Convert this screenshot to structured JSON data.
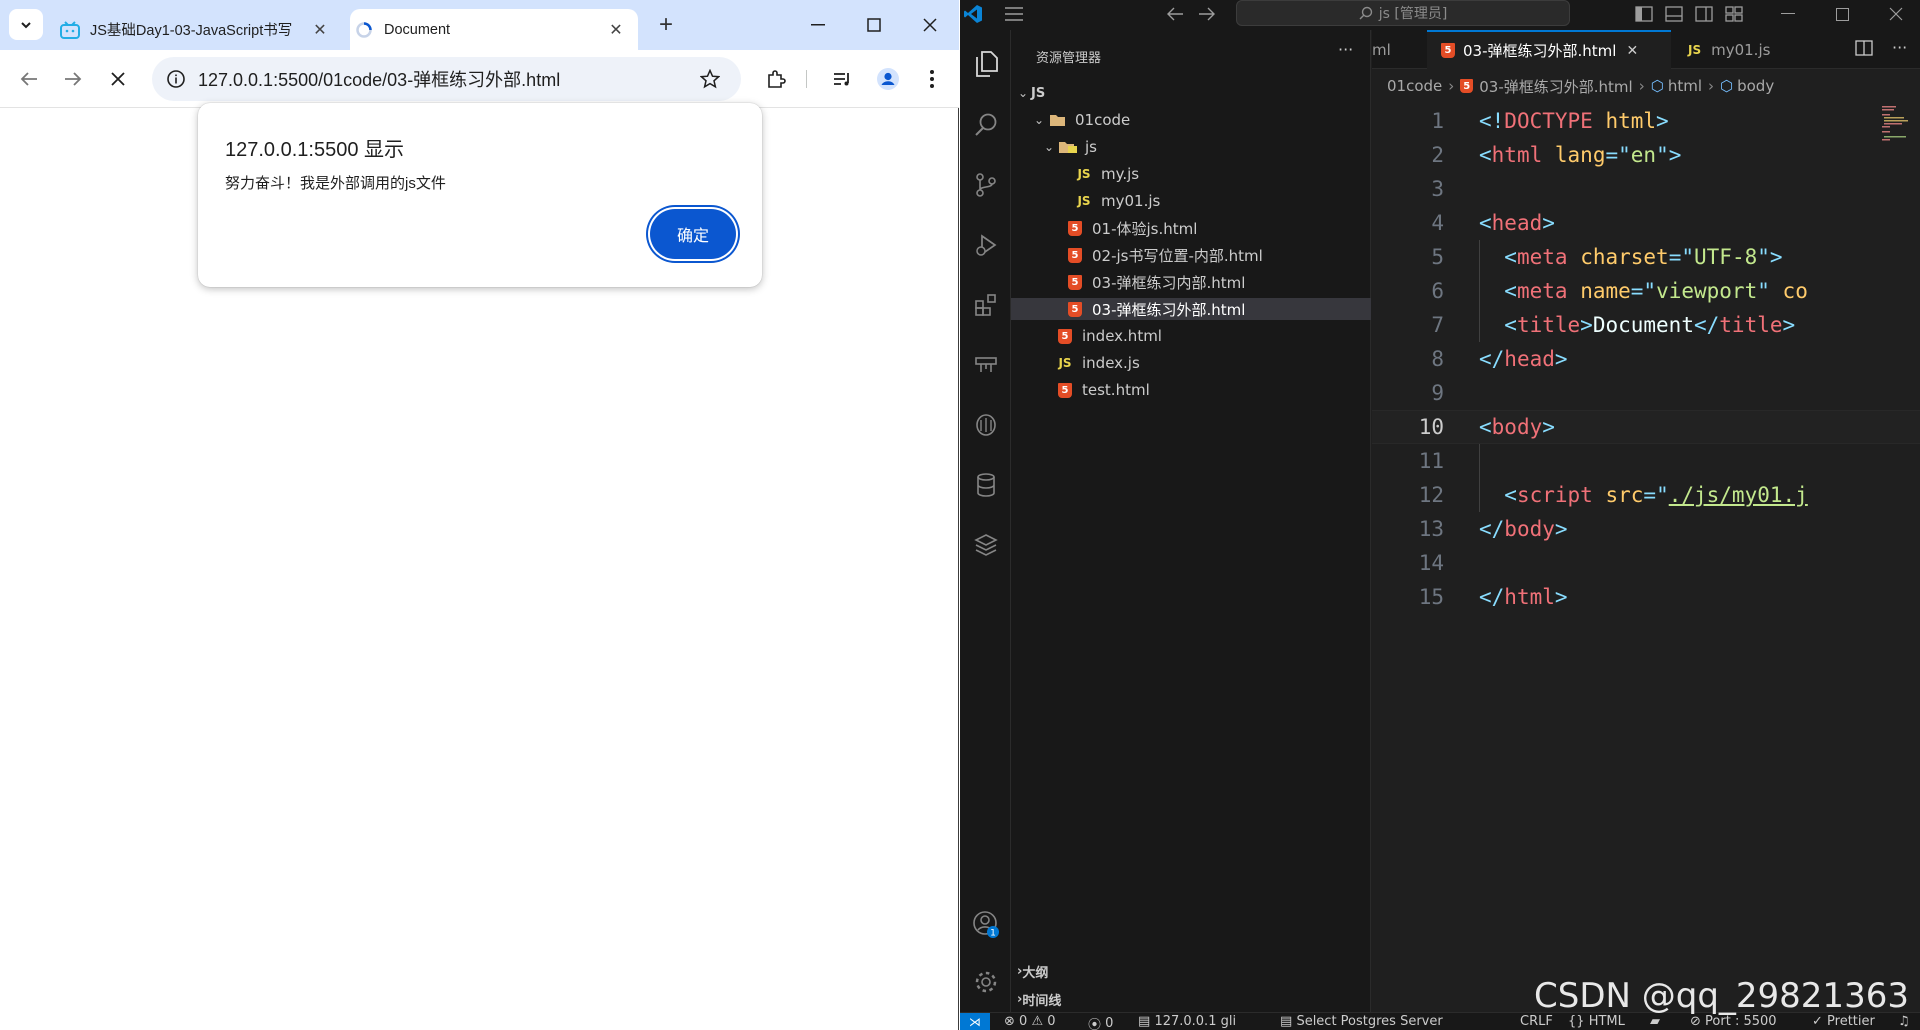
{
  "browser": {
    "tabs": [
      {
        "title": "JS基础Day1-03-JavaScript书写",
        "favicon": "bilibili-icon",
        "active": false
      },
      {
        "title": "Document",
        "favicon": "loading-icon",
        "active": true
      }
    ],
    "url": "127.0.0.1:5500/01code/03-弹框练习外部.html",
    "alert": {
      "title": "127.0.0.1:5500 显示",
      "message": "努力奋斗！我是外部调用的js文件",
      "ok_label": "确定"
    }
  },
  "vscode": {
    "search_placeholder": "js [管理员]",
    "explorer_title": "资源管理器",
    "tree": [
      {
        "label": "JS",
        "type": "root"
      },
      {
        "label": "01code",
        "type": "folder"
      },
      {
        "label": "js",
        "type": "folder"
      },
      {
        "label": "my.js",
        "type": "js"
      },
      {
        "label": "my01.js",
        "type": "js"
      },
      {
        "label": "01-体验js.html",
        "type": "html"
      },
      {
        "label": "02-js书写位置-内部.html",
        "type": "html"
      },
      {
        "label": "03-弹框练习内部.html",
        "type": "html"
      },
      {
        "label": "03-弹框练习外部.html",
        "type": "html",
        "selected": true
      },
      {
        "label": "index.html",
        "type": "html"
      },
      {
        "label": "index.js",
        "type": "js"
      },
      {
        "label": "test.html",
        "type": "html"
      }
    ],
    "outline_label": "大纲",
    "timeline_label": "时间线",
    "editor_tabs": [
      {
        "label": "ml"
      },
      {
        "label": "03-弹框练习外部.html",
        "active": true
      },
      {
        "label": "my01.js"
      }
    ],
    "breadcrumb": [
      "01code",
      "03-弹框练习外部.html",
      "html",
      "body"
    ],
    "code_line_numbers": [
      "1",
      "2",
      "3",
      "4",
      "5",
      "6",
      "7",
      "8",
      "9",
      "10",
      "11",
      "12",
      "13",
      "14",
      "15"
    ],
    "current_line": "10",
    "status": {
      "errors": "0",
      "warnings": "0",
      "ports": "0",
      "server": "127.0.0.1",
      "user": "gli",
      "postgres": "Select Postgres Server",
      "eol": "CRLF",
      "language": "HTML",
      "port": "Port : 5500",
      "formatter": "Prettier"
    }
  },
  "watermark": "CSDN @qq_29821363"
}
